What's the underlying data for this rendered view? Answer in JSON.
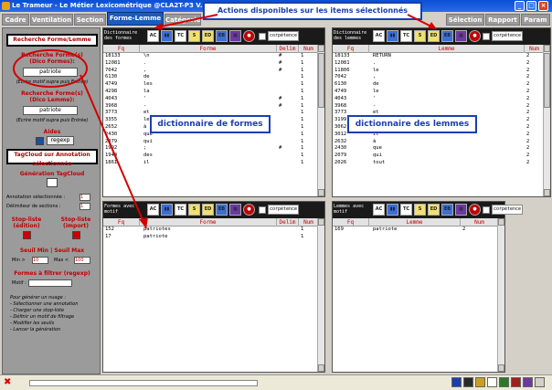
{
  "window": {
    "title": "Le Trameur - Le Métier Lexicométrique @CLA2T-P3 V. 12.18",
    "controls": [
      "_",
      "□",
      "×"
    ]
  },
  "tabs": [
    {
      "label": "Cadre",
      "active": false
    },
    {
      "label": "Ventilation",
      "active": false
    },
    {
      "label": "Section",
      "active": false
    },
    {
      "label": "Forme-Lemme",
      "active": true
    },
    {
      "label": "Catégorie",
      "active": false
    },
    {
      "label": "Sélection",
      "active": false
    },
    {
      "label": "Rapport",
      "active": false
    },
    {
      "label": "Param",
      "active": false
    }
  ],
  "callouts": {
    "actions": "Actions disponibles sur les items sélectionnés",
    "formes": "dictionnaire de formes",
    "lemmes": "dictionnaire des lemmes"
  },
  "sidebar": {
    "search_header": "Recherche Forme/Lemme",
    "search_forme_label": "Recherche Forme(s) (Dico Formes):",
    "search_forme_value": "patriote",
    "search_forme_note": "(Ecrire motif supra puis Entrée)",
    "search_lemme_label": "Recherche Forme(s) (Dico Lemme):",
    "search_lemme_value": "patriote",
    "search_lemme_note": "(Ecrire motif supra puis Entrée)",
    "aides_label": "Aides",
    "regexp_label": "regexp",
    "tagcloud_header": "TagCloud sur Annotation sélectionnée",
    "tagcloud_gen": "Génération TagCloud",
    "annotation_label": "Annotation sélectionnée :",
    "annotation_value": "1",
    "delimiteur_label": "Délimiteur de sections :",
    "delimiteur_value": "1",
    "stoplist_edit": "Stop-liste (édition)",
    "stoplist_import": "Stop-liste (import)",
    "seuil_label": "Seuil Min | Seuil Max",
    "min_label": "Min >",
    "min_value": "10",
    "max_label": "Max <",
    "max_value": "100",
    "filtre_label": "Formes à filtrer (regexp)",
    "motif_label": "Motif :",
    "instructions": [
      "Pour générer un nuage :",
      "- Sélectionner une annotation",
      "- Charger une stop-liste",
      "- Définir un motif de filtrage",
      "- Modifier les seuils",
      "- Lancer la génération"
    ]
  },
  "toolbar_icons": [
    "AC",
    "bar-chart",
    "TC",
    "S",
    "ED",
    "EB",
    "grid",
    "circle"
  ],
  "formes_dict": {
    "label": "Dictionnaire des formes",
    "checkbox": "corpétence",
    "columns": [
      "Fq",
      "Forme",
      "Delim",
      "Num"
    ],
    "rows": [
      [
        "18133",
        "\\n",
        "#",
        "1"
      ],
      [
        "12081",
        ".",
        "#",
        "1"
      ],
      [
        "7042",
        ",",
        "#",
        "1"
      ],
      [
        "6130",
        "de",
        " ",
        "1"
      ],
      [
        "4749",
        "les",
        " ",
        "1"
      ],
      [
        "4298",
        "la",
        " ",
        "1"
      ],
      [
        "4043",
        "'",
        "#",
        "1"
      ],
      [
        "3968",
        "-",
        "#",
        "1"
      ],
      [
        "3773",
        "et",
        " ",
        "1"
      ],
      [
        "3355",
        "le",
        " ",
        "1"
      ],
      [
        "2652",
        "à",
        " ",
        "1"
      ],
      [
        "2430",
        "que",
        " ",
        "1"
      ],
      [
        "2079",
        "qui",
        " ",
        "1"
      ],
      [
        "1992",
        ";",
        "#",
        "1"
      ],
      [
        "1944",
        "des",
        " ",
        "1"
      ],
      [
        "1861",
        "il",
        " ",
        "1"
      ]
    ]
  },
  "lemmes_dict": {
    "label": "Dictionnaire des lemmes",
    "checkbox": "corpétence",
    "columns": [
      "Fq",
      "Lemme",
      "Num"
    ],
    "rows": [
      [
        "18133",
        "RETURN",
        "2"
      ],
      [
        "12081",
        ".",
        "2"
      ],
      [
        "11806",
        "le",
        "2"
      ],
      [
        "7042",
        ",",
        "2"
      ],
      [
        "6130",
        "de",
        "2"
      ],
      [
        "4749",
        "le",
        "2"
      ],
      [
        "4043",
        "'",
        "2"
      ],
      [
        "3968",
        "-",
        "2"
      ],
      [
        "3773",
        "et",
        "2"
      ],
      [
        "3199",
        "avoir",
        "2"
      ],
      [
        "3062",
        "du",
        "2"
      ],
      [
        "3012",
        "il",
        "2"
      ],
      [
        "2632",
        "à",
        "2"
      ],
      [
        "2430",
        "que",
        "2"
      ],
      [
        "2079",
        "qui",
        "2"
      ],
      [
        "2026",
        "tout",
        "2"
      ]
    ]
  },
  "formes_sel": {
    "label": "Formes avec motif",
    "checkbox": "corpétence",
    "columns": [
      "Fq",
      "Forme",
      "Delim",
      "Num"
    ],
    "rows": [
      [
        "152",
        "patriotes",
        " ",
        "1"
      ],
      [
        "17",
        "patriote",
        " ",
        "1"
      ]
    ]
  },
  "lemmes_sel": {
    "label": "Lemmes avec motif",
    "checkbox": "corpétence",
    "columns": [
      "Fq",
      "Lemme",
      "Num"
    ],
    "rows": [
      [
        "169",
        "patriote",
        "2"
      ]
    ]
  },
  "colors": {
    "accent": "#1c5bb8",
    "header_red": "#c00000",
    "callout_blue": "#1a3fb0",
    "annotation_red": "#d40000"
  }
}
